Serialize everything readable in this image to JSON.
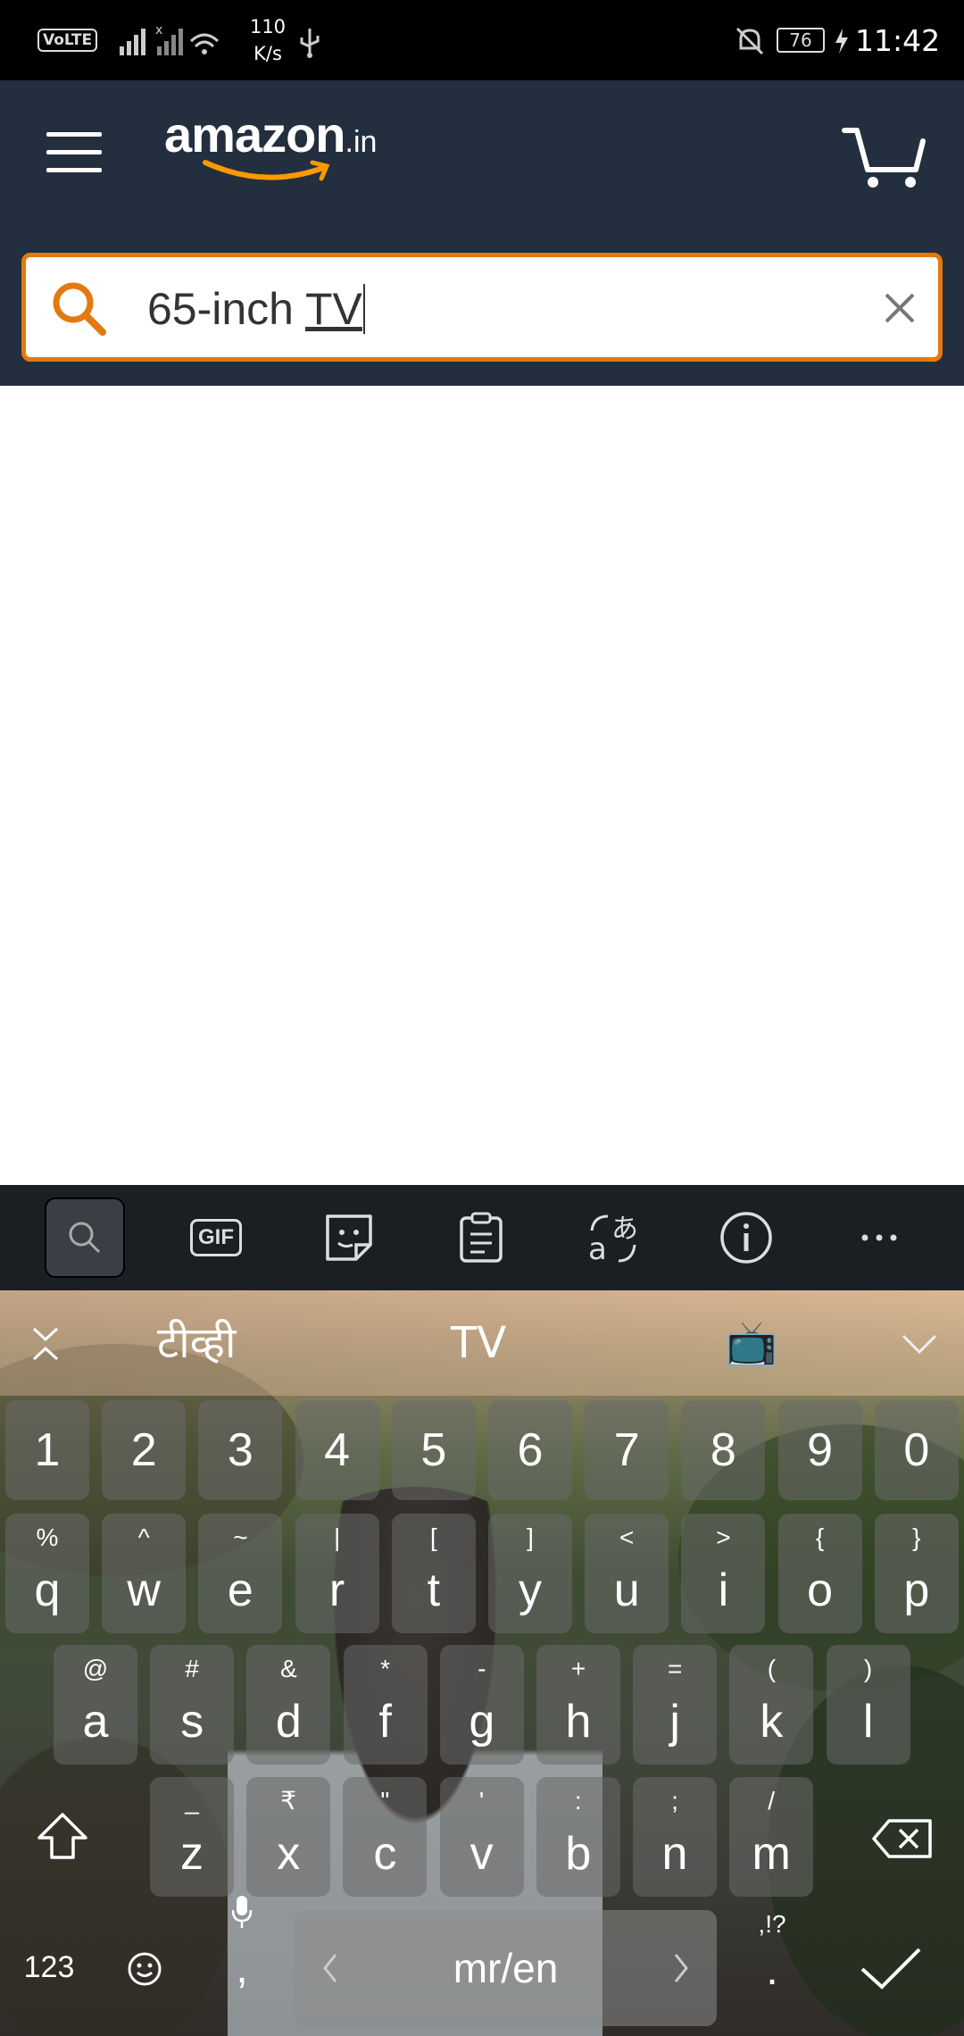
{
  "status_bar": {
    "volte": "VoLTE",
    "net_speed_value": "110",
    "net_speed_unit": "K/s",
    "battery": "76",
    "time": "11:42"
  },
  "header": {
    "logo_brand": "amazon",
    "logo_tld": ".in",
    "accent_color": "#e47911",
    "bg_color": "#232f3e"
  },
  "search": {
    "query_prefix": "65-inch ",
    "query_word": "TV"
  },
  "keyboard": {
    "toolbar_icons": [
      "search-icon",
      "gif-icon",
      "sticker-icon",
      "clipboard-icon",
      "translate-icon",
      "info-icon",
      "more-icon"
    ],
    "gif_label": "GIF",
    "suggestions": [
      "टीव्ही",
      "TV",
      "📺"
    ],
    "number_row": [
      "1",
      "2",
      "3",
      "4",
      "5",
      "6",
      "7",
      "8",
      "9",
      "0"
    ],
    "row1": [
      {
        "hint": "%",
        "key": "q"
      },
      {
        "hint": "^",
        "key": "w"
      },
      {
        "hint": "~",
        "key": "e"
      },
      {
        "hint": "|",
        "key": "r"
      },
      {
        "hint": "[",
        "key": "t"
      },
      {
        "hint": "]",
        "key": "y"
      },
      {
        "hint": "<",
        "key": "u"
      },
      {
        "hint": ">",
        "key": "i"
      },
      {
        "hint": "{",
        "key": "o"
      },
      {
        "hint": "}",
        "key": "p"
      }
    ],
    "row2": [
      {
        "hint": "@",
        "key": "a"
      },
      {
        "hint": "#",
        "key": "s"
      },
      {
        "hint": "&",
        "key": "d"
      },
      {
        "hint": "*",
        "key": "f"
      },
      {
        "hint": "-",
        "key": "g"
      },
      {
        "hint": "+",
        "key": "h"
      },
      {
        "hint": "=",
        "key": "j"
      },
      {
        "hint": "(",
        "key": "k"
      },
      {
        "hint": ")",
        "key": "l"
      }
    ],
    "row3": [
      {
        "hint": "_",
        "key": "z"
      },
      {
        "hint": "₹",
        "key": "x"
      },
      {
        "hint": "\"",
        "key": "c"
      },
      {
        "hint": "'",
        "key": "v"
      },
      {
        "hint": ":",
        "key": "b"
      },
      {
        "hint": ";",
        "key": "n"
      },
      {
        "hint": "/",
        "key": "m"
      }
    ],
    "num_switch": "123",
    "comma": ",",
    "space_label": "mr/en",
    "punct_hint": ",!?",
    "period": "."
  }
}
